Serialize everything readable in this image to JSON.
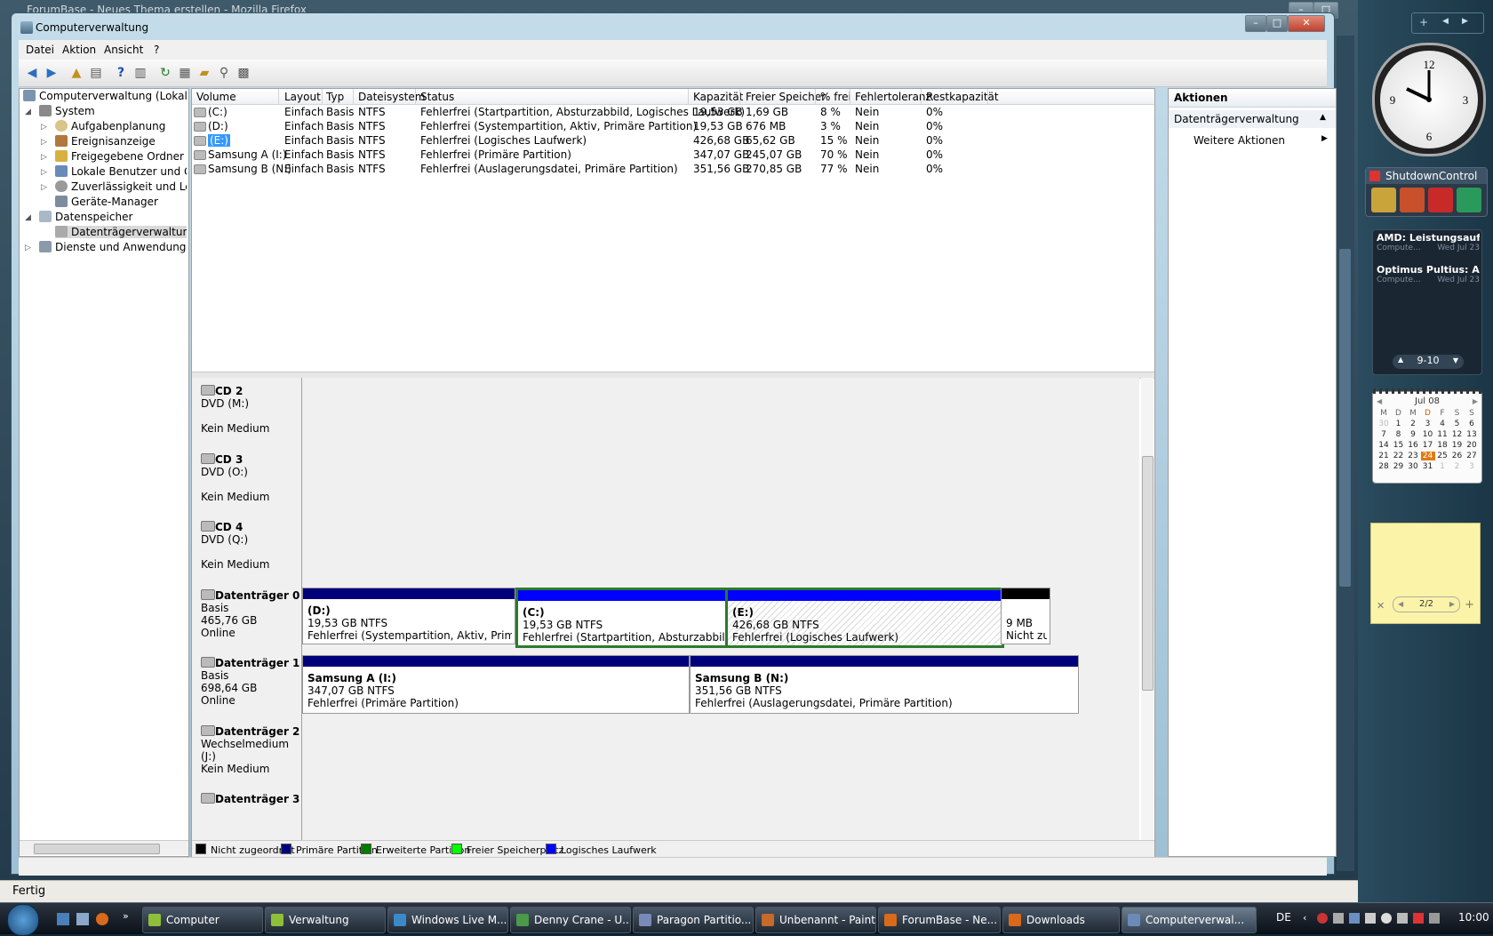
{
  "firefox": {
    "title": "ForumBase - Neues Thema erstellen - Mozilla Firefox",
    "status": "Fertig"
  },
  "window": {
    "title": "Computerverwaltung",
    "menu": [
      "Datei",
      "Aktion",
      "Ansicht",
      "?"
    ]
  },
  "tree": {
    "items": [
      {
        "label": "Computerverwaltung (Lokal)",
        "level": 0,
        "expander": ""
      },
      {
        "label": "System",
        "level": 1,
        "expander": "◢"
      },
      {
        "label": "Aufgabenplanung",
        "level": 2,
        "expander": "▷"
      },
      {
        "label": "Ereignisanzeige",
        "level": 2,
        "expander": "▷"
      },
      {
        "label": "Freigegebene Ordner",
        "level": 2,
        "expander": "▷"
      },
      {
        "label": "Lokale Benutzer und Gru",
        "level": 2,
        "expander": "▷"
      },
      {
        "label": "Zuverlässigkeit und Leis",
        "level": 2,
        "expander": "▷"
      },
      {
        "label": "Geräte-Manager",
        "level": 2,
        "expander": ""
      },
      {
        "label": "Datenspeicher",
        "level": 1,
        "expander": "◢"
      },
      {
        "label": "Datenträgerverwaltung",
        "level": 2,
        "expander": "",
        "selected": true
      },
      {
        "label": "Dienste und Anwendungen",
        "level": 1,
        "expander": "▷"
      }
    ]
  },
  "volumes": {
    "columns": [
      "Volume",
      "Layout",
      "Typ",
      "Dateisystem",
      "Status",
      "Kapazität",
      "Freier Speicher",
      "% frei",
      "Fehlertoleranz",
      "Restkapazität"
    ],
    "rows": [
      [
        "(C:)",
        "Einfach",
        "Basis",
        "NTFS",
        "Fehlerfrei (Startpartition, Absturzabbild, Logisches Laufwerk)",
        "19,53 GB",
        "1,69 GB",
        "8 %",
        "Nein",
        "0%"
      ],
      [
        "(D:)",
        "Einfach",
        "Basis",
        "NTFS",
        "Fehlerfrei (Systempartition, Aktiv, Primäre Partition)",
        "19,53 GB",
        "676 MB",
        "3 %",
        "Nein",
        "0%"
      ],
      [
        "(E:)",
        "Einfach",
        "Basis",
        "NTFS",
        "Fehlerfrei (Logisches Laufwerk)",
        "426,68 GB",
        "65,62 GB",
        "15 %",
        "Nein",
        "0%"
      ],
      [
        "Samsung A (I:)",
        "Einfach",
        "Basis",
        "NTFS",
        "Fehlerfrei (Primäre Partition)",
        "347,07 GB",
        "245,07 GB",
        "70 %",
        "Nein",
        "0%"
      ],
      [
        "Samsung B (N:)",
        "Einfach",
        "Basis",
        "NTFS",
        "Fehlerfrei (Auslagerungsdatei, Primäre Partition)",
        "351,56 GB",
        "270,85 GB",
        "77 %",
        "Nein",
        "0%"
      ]
    ]
  },
  "disks": [
    {
      "name": "CD 2",
      "line2": "DVD (M:)",
      "line3": "",
      "line4": "Kein Medium"
    },
    {
      "name": "CD 3",
      "line2": "DVD (O:)",
      "line3": "",
      "line4": "Kein Medium"
    },
    {
      "name": "CD 4",
      "line2": "DVD (Q:)",
      "line3": "",
      "line4": "Kein Medium"
    },
    {
      "name": "Datenträger 0",
      "line2": "Basis",
      "line3": "465,76 GB",
      "line4": "Online"
    },
    {
      "name": "Datenträger 1",
      "line2": "Basis",
      "line3": "698,64 GB",
      "line4": "Online"
    },
    {
      "name": "Datenträger 2",
      "line2": "Wechselmedium (J:)",
      "line3": "",
      "line4": "Kein Medium"
    },
    {
      "name": "Datenträger 3",
      "line2": "",
      "line3": "",
      "line4": ""
    }
  ],
  "partitions": {
    "disk0": [
      {
        "name": "(D:)",
        "size": "19,53 GB NTFS",
        "status": "Fehlerfrei (Systempartition, Aktiv, Primäre Par"
      },
      {
        "name": "(C:)",
        "size": "19,53 GB NTFS",
        "status": "Fehlerfrei (Startpartition, Absturzabbild, Logis"
      },
      {
        "name": "(E:)",
        "size": "426,68 GB NTFS",
        "status": "Fehlerfrei (Logisches Laufwerk)"
      },
      {
        "name": "",
        "size": "9 MB",
        "status": "Nicht zu"
      }
    ],
    "disk1": [
      {
        "name": "Samsung A  (I:)",
        "size": "347,07 GB NTFS",
        "status": "Fehlerfrei (Primäre Partition)"
      },
      {
        "name": "Samsung B  (N:)",
        "size": "351,56 GB NTFS",
        "status": "Fehlerfrei (Auslagerungsdatei, Primäre Partition)"
      }
    ]
  },
  "legend": [
    {
      "label": "Nicht zugeordnet",
      "color": "#000000"
    },
    {
      "label": "Primäre Partition",
      "color": "#00007b"
    },
    {
      "label": "Erweiterte Partition",
      "color": "#007b00"
    },
    {
      "label": "Freier Speicherplatz",
      "color": "#00ff00"
    },
    {
      "label": "Logisches Laufwerk",
      "color": "#0000ff"
    }
  ],
  "actions": {
    "header": "Aktionen",
    "section": "Datenträgerverwaltung",
    "more": "Weitere Aktionen"
  },
  "sidebar": {
    "shutdown_title": "ShutdownControl",
    "feeds": [
      {
        "title": "AMD: Leistungsaufn...",
        "source": "Compute...",
        "date": "Wed Jul 23"
      },
      {
        "title": "Optimus Pultius: Art ...",
        "source": "Compute...",
        "date": "Wed Jul 23"
      }
    ],
    "feed_pager": "9-10",
    "calendar": {
      "month": "Jul 08",
      "weekdays": [
        "M",
        "D",
        "M",
        "D",
        "F",
        "S",
        "S"
      ],
      "days": [
        "30",
        "1",
        "2",
        "3",
        "4",
        "5",
        "6",
        "7",
        "8",
        "9",
        "10",
        "11",
        "12",
        "13",
        "14",
        "15",
        "16",
        "17",
        "18",
        "19",
        "20",
        "21",
        "22",
        "23",
        "24",
        "25",
        "26",
        "27",
        "28",
        "29",
        "30",
        "31",
        "1",
        "2",
        "3"
      ],
      "today": "24"
    },
    "notes_pager": "2/2"
  },
  "taskbar": {
    "buttons": [
      "Computer",
      "Verwaltung",
      "Windows Live M...",
      "Denny Crane - U...",
      "Paragon Partitio...",
      "Unbenannt - Paint",
      "ForumBase - Ne...",
      "Downloads",
      "Computerverwal..."
    ],
    "lang": "DE",
    "clock": "10:00"
  }
}
